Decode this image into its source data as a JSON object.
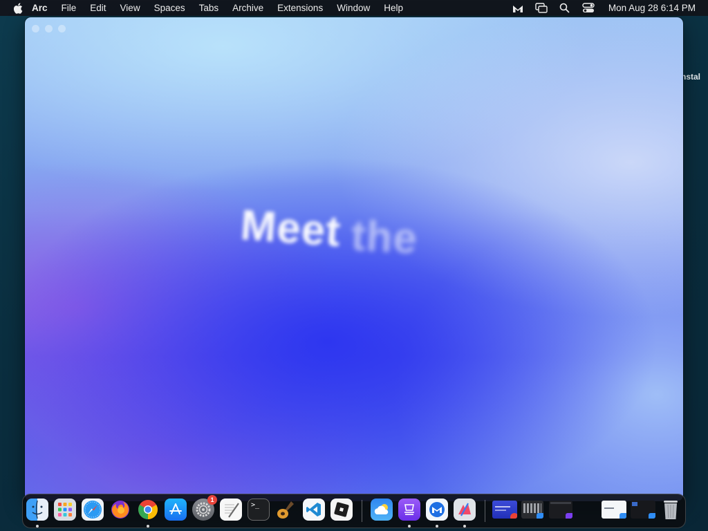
{
  "menubar": {
    "app_name": "Arc",
    "menus": [
      "File",
      "Edit",
      "View",
      "Spaces",
      "Tabs",
      "Archive",
      "Extensions",
      "Window",
      "Help"
    ],
    "clock": "Mon Aug 28  6:14 PM",
    "status_icons": [
      "malwarebytes-icon",
      "screen-mirroring-icon",
      "search-icon",
      "control-center-icon"
    ]
  },
  "background_window": {
    "peek_text": "nstal"
  },
  "arc_window": {
    "hero_word_1": "Meet",
    "hero_word_2": "the"
  },
  "dock": {
    "apps": [
      {
        "name": "finder-icon",
        "running": true
      },
      {
        "name": "launchpad-icon",
        "running": false
      },
      {
        "name": "safari-icon",
        "running": false
      },
      {
        "name": "firefox-icon",
        "running": false
      },
      {
        "name": "chrome-icon",
        "running": true
      },
      {
        "name": "app-store-icon",
        "running": false
      },
      {
        "name": "system-settings-icon",
        "running": false,
        "badge": "1"
      },
      {
        "name": "textedit-icon",
        "running": false
      },
      {
        "name": "terminal-icon",
        "running": false
      },
      {
        "name": "garageband-icon",
        "running": false
      },
      {
        "name": "vscode-icon",
        "running": false
      },
      {
        "name": "roblox-icon",
        "running": false
      },
      {
        "name": "weather-icon",
        "running": false
      },
      {
        "name": "arc-helper-icon",
        "running": true
      },
      {
        "name": "malwarebytes-icon",
        "running": true
      },
      {
        "name": "app-cleaner-icon",
        "running": true
      }
    ],
    "terminal_glyph": ">_",
    "colors": {
      "finder": "#2f8df5",
      "chrome": "#ea4335",
      "vscode": "#1f8ad2",
      "badge": "#e8443a",
      "arc_accent": "#7b3ff0"
    }
  }
}
